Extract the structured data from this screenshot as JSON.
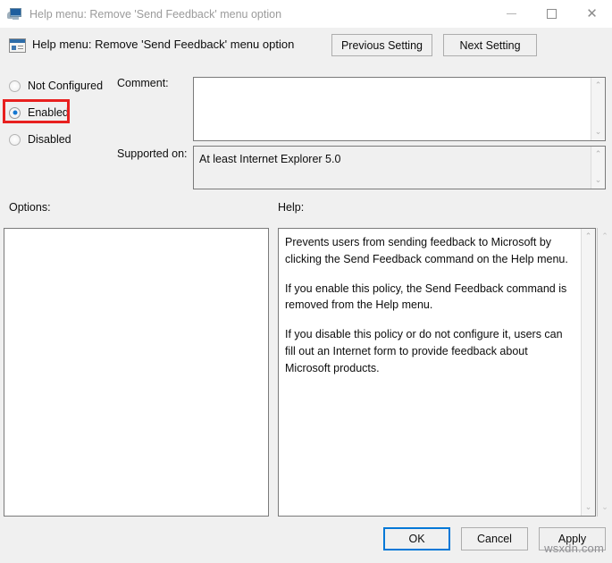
{
  "window": {
    "title": "Help menu: Remove 'Send Feedback' menu option",
    "title_icon": "computer-monitor-icon",
    "controls": {
      "minimize": "minimize-icon",
      "maximize": "maximize-icon",
      "close": "✕"
    }
  },
  "header": {
    "icon": "policy-setting-icon",
    "title": "Help menu: Remove 'Send Feedback' menu option",
    "previous_label": "Previous Setting",
    "next_label": "Next Setting"
  },
  "state_options": {
    "items": [
      {
        "label": "Not Configured",
        "checked": false
      },
      {
        "label": "Enabled",
        "checked": true
      },
      {
        "label": "Disabled",
        "checked": false
      }
    ],
    "highlight_color": "#e8201f"
  },
  "comment": {
    "label": "Comment:",
    "value": "",
    "placeholder": ""
  },
  "supported_on": {
    "label": "Supported on:",
    "value": "At least Internet Explorer 5.0"
  },
  "options_panel": {
    "label": "Options:",
    "value": ""
  },
  "help_panel": {
    "label": "Help:",
    "paragraphs": [
      "Prevents users from sending feedback to Microsoft by clicking the Send Feedback command on the Help menu.",
      "If you enable this policy, the Send Feedback command is removed from the Help menu.",
      "If you disable this policy or do not configure it, users can fill out an Internet form to provide feedback about Microsoft products."
    ]
  },
  "scrollbars": {
    "up_glyph": "⌃",
    "down_glyph": "⌄"
  },
  "footer": {
    "ok_label": "OK",
    "cancel_label": "Cancel",
    "apply_label": "Apply"
  },
  "watermark": {
    "text": "wsxdn.com"
  }
}
